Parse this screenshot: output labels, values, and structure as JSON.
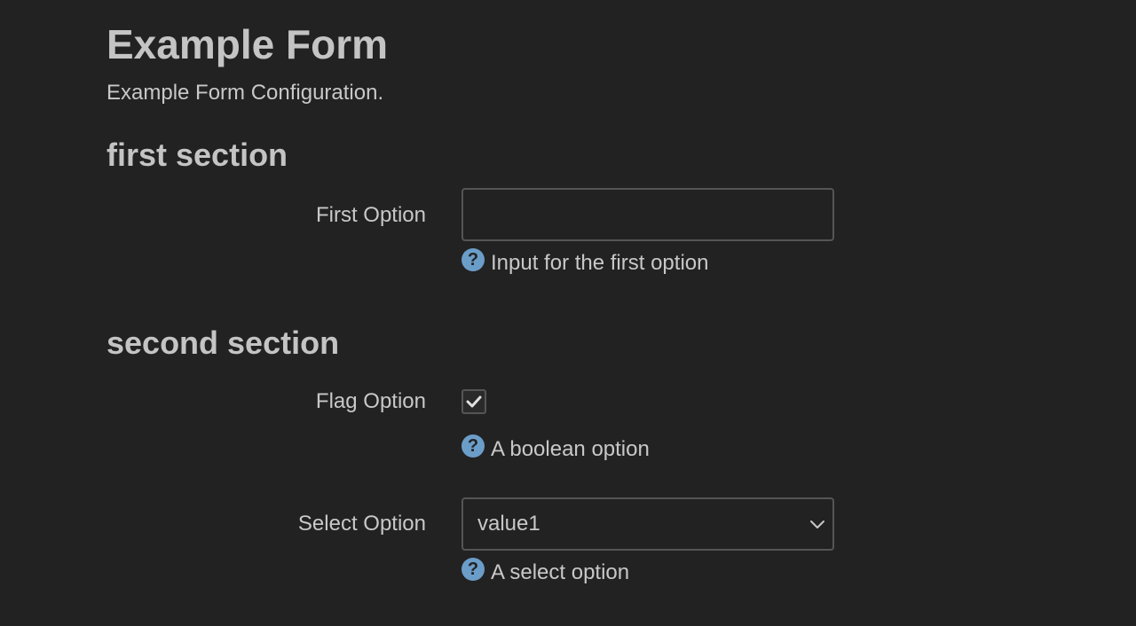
{
  "header": {
    "title": "Example Form",
    "description": "Example Form Configuration."
  },
  "sections": [
    {
      "title": "first section",
      "fields": [
        {
          "label": "First Option",
          "type": "text",
          "value": "",
          "placeholder": "",
          "help_icon": "question-circle-icon",
          "help": "Input for the first option"
        }
      ]
    },
    {
      "title": "second section",
      "fields": [
        {
          "label": "Flag Option",
          "type": "checkbox",
          "checked": true,
          "check_icon": "checkmark-icon",
          "help_icon": "question-circle-icon",
          "help": "A boolean option"
        },
        {
          "label": "Select Option",
          "type": "select",
          "value": "value1",
          "dropdown_icon": "chevron-down-icon",
          "help_icon": "question-circle-icon",
          "help": "A select option"
        }
      ]
    }
  ],
  "colors": {
    "background": "#222222",
    "text": "#c8c8c8",
    "border": "#555555",
    "help_icon": "#6b9dc9"
  }
}
